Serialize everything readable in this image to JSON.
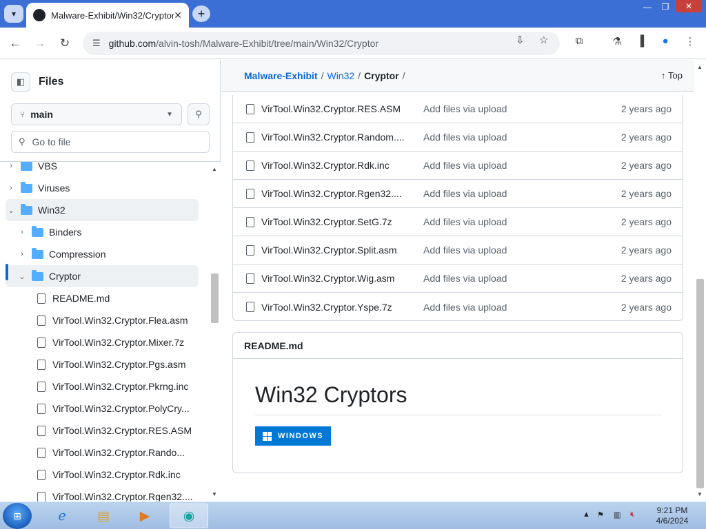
{
  "browser": {
    "tab_title": "Malware-Exhibit/Win32/Cryptor",
    "tab_close": "✕",
    "new_tab": "+",
    "url_host": "github.com",
    "url_path": "/alvin-tosh/Malware-Exhibit/tree/main/Win32/Cryptor",
    "window_controls": [
      "—",
      "❐",
      "✕"
    ]
  },
  "sidebar": {
    "title": "Files",
    "branch": "main",
    "go_to_file_placeholder": "Go to file",
    "tree": [
      {
        "label": "VBS",
        "type": "folder",
        "expanded": false,
        "level": 0
      },
      {
        "label": "Viruses",
        "type": "folder",
        "expanded": false,
        "level": 0
      },
      {
        "label": "Win32",
        "type": "folder",
        "expanded": true,
        "level": 0
      },
      {
        "label": "Binders",
        "type": "folder",
        "expanded": false,
        "level": 1
      },
      {
        "label": "Compression",
        "type": "folder",
        "expanded": false,
        "level": 1
      },
      {
        "label": "Cryptor",
        "type": "folder",
        "expanded": true,
        "level": 1,
        "selected": true
      },
      {
        "label": "README.md",
        "type": "file",
        "level": 2
      },
      {
        "label": "VirTool.Win32.Cryptor.Flea.asm",
        "type": "file",
        "level": 2
      },
      {
        "label": "VirTool.Win32.Cryptor.Mixer.7z",
        "type": "file",
        "level": 2
      },
      {
        "label": "VirTool.Win32.Cryptor.Pgs.asm",
        "type": "file",
        "level": 2
      },
      {
        "label": "VirTool.Win32.Cryptor.Pkrng.inc",
        "type": "file",
        "level": 2
      },
      {
        "label": "VirTool.Win32.Cryptor.PolyCry...",
        "type": "file",
        "level": 2
      },
      {
        "label": "VirTool.Win32.Cryptor.RES.ASM",
        "type": "file",
        "level": 2
      },
      {
        "label": "VirTool.Win32.Cryptor.Rando...",
        "type": "file",
        "level": 2
      },
      {
        "label": "VirTool.Win32.Cryptor.Rdk.inc",
        "type": "file",
        "level": 2
      },
      {
        "label": "VirTool.Win32.Cryptor.Rgen32....",
        "type": "file",
        "level": 2
      }
    ]
  },
  "breadcrumb": {
    "repo": "Malware-Exhibit",
    "folder": "Win32",
    "current": "Cryptor",
    "sep": "/",
    "top_label": "Top"
  },
  "files": [
    {
      "name": "VirTool.Win32.Cryptor.RES.ASM",
      "commit": "Add files via upload",
      "age": "2 years ago"
    },
    {
      "name": "VirTool.Win32.Cryptor.Random....",
      "commit": "Add files via upload",
      "age": "2 years ago"
    },
    {
      "name": "VirTool.Win32.Cryptor.Rdk.inc",
      "commit": "Add files via upload",
      "age": "2 years ago"
    },
    {
      "name": "VirTool.Win32.Cryptor.Rgen32....",
      "commit": "Add files via upload",
      "age": "2 years ago"
    },
    {
      "name": "VirTool.Win32.Cryptor.SetG.7z",
      "commit": "Add files via upload",
      "age": "2 years ago"
    },
    {
      "name": "VirTool.Win32.Cryptor.Split.asm",
      "commit": "Add files via upload",
      "age": "2 years ago"
    },
    {
      "name": "VirTool.Win32.Cryptor.Wig.asm",
      "commit": "Add files via upload",
      "age": "2 years ago"
    },
    {
      "name": "VirTool.Win32.Cryptor.Yspe.7z",
      "commit": "Add files via upload",
      "age": "2 years ago"
    }
  ],
  "readme": {
    "filename": "README.md",
    "heading": "Win32 Cryptors",
    "badge": "WINDOWS"
  },
  "taskbar": {
    "clock_time": "9:21 PM",
    "clock_date": "4/6/2024"
  },
  "colors": {
    "accent": "#0969da",
    "folder": "#54aeff",
    "badge_bg": "#0078d6",
    "chrome_frame": "#3c6fd6"
  }
}
